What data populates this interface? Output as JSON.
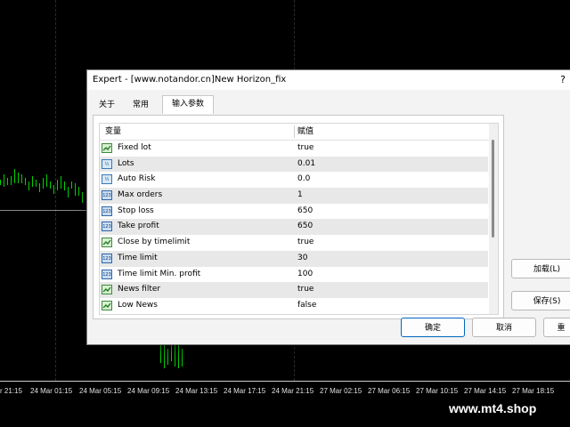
{
  "dialog": {
    "title": "Expert - [www.notandor.cn]New Horizon_fix",
    "help": "?",
    "tabs": [
      {
        "label": "关于"
      },
      {
        "label": "常用"
      },
      {
        "label": "输入参数"
      }
    ],
    "columns": {
      "variable": "变量",
      "value": "赋值"
    },
    "params": [
      {
        "icon": "bool",
        "icon_text": "",
        "name": "Fixed lot",
        "value": "true"
      },
      {
        "icon": "dbl",
        "icon_text": "½",
        "name": "Lots",
        "value": "0.01"
      },
      {
        "icon": "dbl",
        "icon_text": "½",
        "name": "Auto Risk",
        "value": "0.0"
      },
      {
        "icon": "int",
        "icon_text": "123",
        "name": "Max orders",
        "value": "1"
      },
      {
        "icon": "int",
        "icon_text": "123",
        "name": "Stop loss",
        "value": "650"
      },
      {
        "icon": "int",
        "icon_text": "123",
        "name": "Take profit",
        "value": "650"
      },
      {
        "icon": "bool",
        "icon_text": "",
        "name": "Close by timelimit",
        "value": "true"
      },
      {
        "icon": "int",
        "icon_text": "123",
        "name": "Time limit",
        "value": "30"
      },
      {
        "icon": "int",
        "icon_text": "123",
        "name": "Time limit Min. profit",
        "value": "100"
      },
      {
        "icon": "bool",
        "icon_text": "",
        "name": "News filter",
        "value": "true"
      },
      {
        "icon": "bool",
        "icon_text": "",
        "name": "Low News",
        "value": "false"
      }
    ],
    "buttons": {
      "load": "加载(L)",
      "save": "保存(S)",
      "ok": "确定",
      "cancel": "取消",
      "reset": "重"
    }
  },
  "time_axis": [
    "r 21:15",
    "24 Mar 01:15",
    "24 Mar 05:15",
    "24 Mar 09:15",
    "24 Mar 13:15",
    "24 Mar 17:15",
    "24 Mar 21:15",
    "27 Mar 02:15",
    "27 Mar 06:15",
    "27 Mar 10:15",
    "27 Mar 14:15",
    "27 Mar 18:15"
  ],
  "watermark": "www.mt4.shop",
  "colors": {
    "candles": "#00d000",
    "background": "#000000",
    "accent": "#0067c0"
  }
}
